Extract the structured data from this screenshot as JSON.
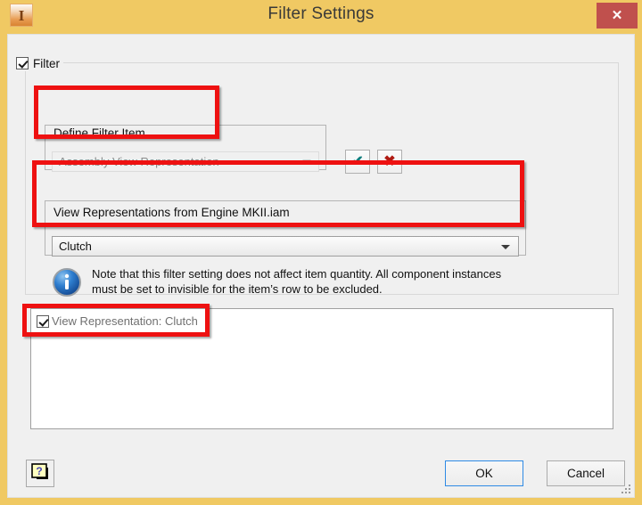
{
  "window": {
    "title": "Filter Settings",
    "app_icon": "inventor-icon",
    "close_label": "✕",
    "titlebar_color": "#f0c963",
    "close_button_color": "#c0504d",
    "dialog_background": "#f0f0f0"
  },
  "filter_group": {
    "label": "Filter",
    "checked": true
  },
  "define_filter_item": {
    "label": "Define Filter Item",
    "combo": {
      "value": "Assembly View Representation",
      "enabled": false,
      "icon": "chevron-down-icon"
    },
    "accept_button": {
      "glyph": "✔",
      "name": "accept-filter-button",
      "color": "#0f7d7d"
    },
    "reject_button": {
      "glyph": "✖",
      "name": "reject-filter-button",
      "color": "#b01a12"
    }
  },
  "view_representations": {
    "label": "View Representations from Engine MKII.iam",
    "combo": {
      "value": "Clutch",
      "enabled": true,
      "icon": "chevron-down-icon"
    }
  },
  "note": {
    "icon": "info-icon",
    "text": "Note that this filter setting does not affect item quantity. All component instances must be set to invisible for the item’s row to be excluded."
  },
  "filter_list": {
    "items": [
      {
        "label": "View Representation: Clutch",
        "checked": true
      }
    ]
  },
  "footer": {
    "help_label": "?",
    "help_icon": "help-icon",
    "ok_label": "OK",
    "cancel_label": "Cancel",
    "ok_focus_color": "#2e8ae5",
    "resize_grip": "resize-grip-icon"
  },
  "annotations": {
    "color": "#ee1111",
    "boxes": [
      "define-filter-item-group",
      "view-representations-group",
      "view-representation-clutch-list-item"
    ]
  }
}
